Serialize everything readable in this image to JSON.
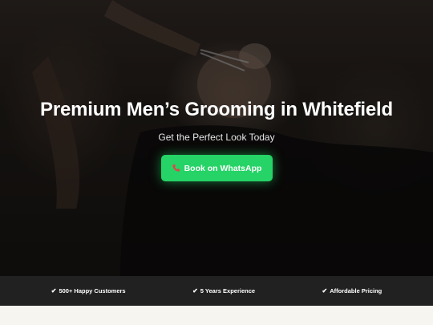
{
  "hero": {
    "title": "Premium Men’s Grooming in Whitefield",
    "subtitle": "Get the Perfect Look Today",
    "cta_icon": "phone-icon",
    "cta_label": "Book on WhatsApp"
  },
  "trust_bar": {
    "items": [
      {
        "icon": "check-icon",
        "glyph": "✔",
        "label": "500+ Happy Customers"
      },
      {
        "icon": "check-icon",
        "glyph": "✔",
        "label": "5 Years Experience"
      },
      {
        "icon": "check-icon",
        "glyph": "✔",
        "label": "Affordable Pricing"
      }
    ]
  },
  "colors": {
    "cta": "#25d366",
    "trust_bar": "#212121",
    "page_background": "#f7f5ef"
  }
}
